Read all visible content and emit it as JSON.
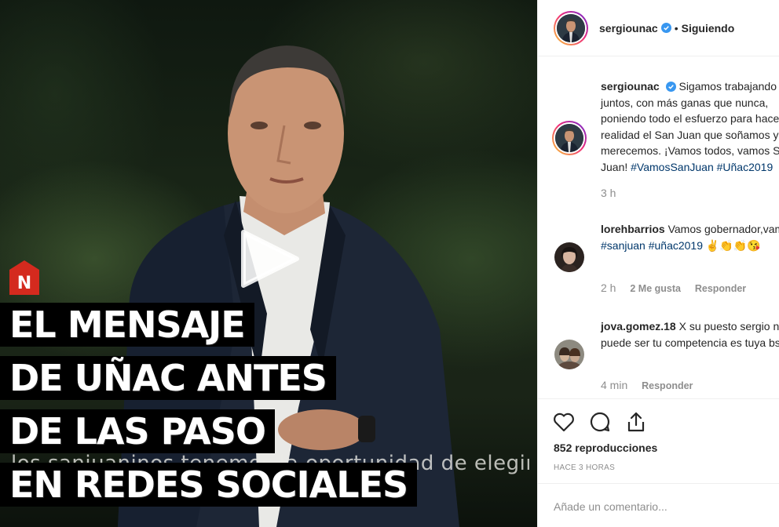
{
  "video": {
    "subtitle": "los sanjuaninos tenemos la oportunidad de elegir.",
    "logo_letter": "N",
    "headline": {
      "line1": "EL MENSAJE",
      "line2": "DE UÑAC ANTES",
      "line3": "DE LAS PASO",
      "line4": "EN REDES SOCIALES"
    }
  },
  "post": {
    "username": "sergiounac",
    "separator": "•",
    "follow_status": "Siguiendo"
  },
  "comments": [
    {
      "username": "sergiounac",
      "text": "Sigamos trabajando juntos, con más ganas que nunca, poniendo todo el esfuerzo para hacer realidad el San Juan que soñamos y nos merecemos. ¡Vamos todos, vamos San Juan!",
      "tags": "#VamosSanJuan #Uñac2019",
      "time": "3 h"
    },
    {
      "username": "lorehbarrios",
      "text": "Vamos gobernador,vamos",
      "tags": "#sanjuan #uñac2019",
      "emoji": "✌👏👏😘",
      "time": "2 h",
      "likes": "2 Me gusta",
      "reply": "Responder"
    },
    {
      "username": "jova.gomez.18",
      "text": "X su puesto sergio nadie puede ser tu competencia es tuya bs tkm",
      "time": "4 min",
      "reply": "Responder"
    }
  ],
  "actions": {
    "views": "852 reproducciones",
    "posted_ago": "HACE 3 HORAS"
  },
  "add_comment": {
    "placeholder": "Añade un comentario..."
  },
  "colors": {
    "link": "#00376b",
    "verified": "#3897f0",
    "muted": "#8e8e8e",
    "logo_red": "#d42a1e"
  }
}
